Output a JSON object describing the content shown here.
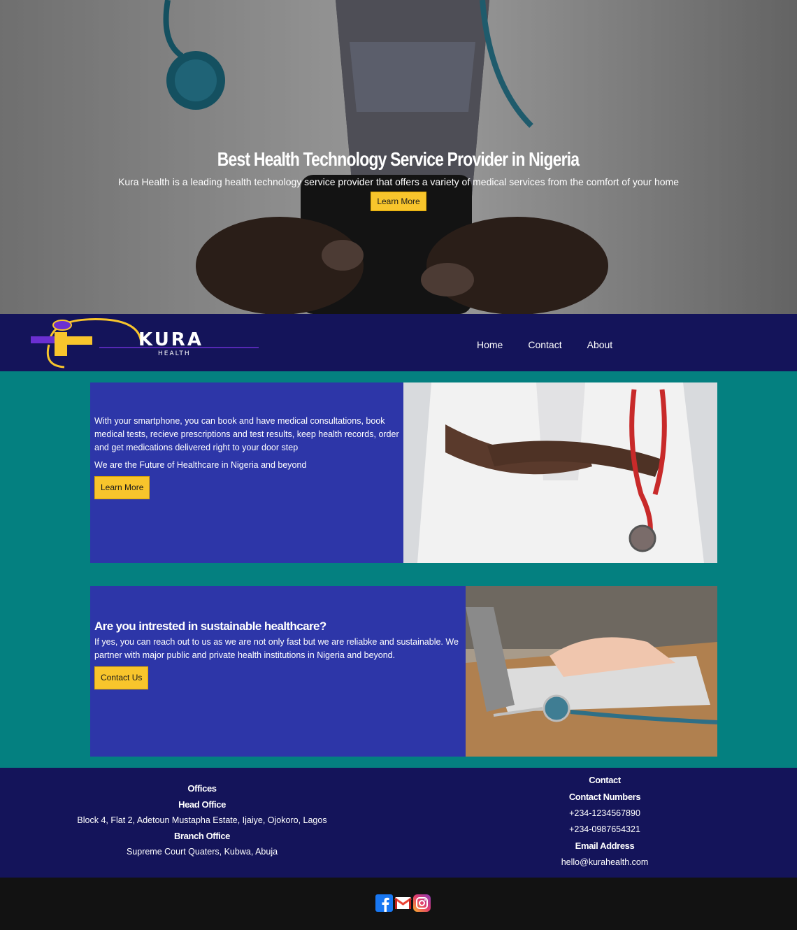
{
  "hero": {
    "title": "Best Health Technology Service Provider in Nigeria",
    "subtitle": "Kura Health is a leading health technology service provider that offers a variety of medical services from the comfort of your home",
    "button_label": "Learn More"
  },
  "nav": {
    "logo_text": "KURA",
    "logo_subtext": "HEALTH",
    "items": [
      {
        "label": "Home"
      },
      {
        "label": "Contact"
      },
      {
        "label": "About"
      }
    ]
  },
  "section1": {
    "paragraph": "With your smartphone, you can book and have medical consultations, book medical tests, recieve prescriptions and test results, keep health records, order and get medications delivered right to your door step",
    "tagline": "We are the Future of Healthcare in Nigeria and beyond",
    "button_label": "Learn More"
  },
  "section2": {
    "heading": "Are you intrested in sustainable healthcare?",
    "paragraph": "If yes, you can reach out to us as we are not only fast but we are reliabke and sustainable. We partner with major public and private health institutions in Nigeria and beyond.",
    "button_label": "Contact Us"
  },
  "footer": {
    "offices": {
      "heading": "Offices",
      "head_office_label": "Head Office",
      "head_office_address": "Block 4, Flat 2, Adetoun Mustapha Estate, Ijaiye, Ojokoro, Lagos",
      "branch_office_label": "Branch Office",
      "branch_office_address": "Supreme Court Quaters, Kubwa, Abuja"
    },
    "contact": {
      "heading": "Contact",
      "numbers_label": "Contact Numbers",
      "phone1": "+234-1234567890",
      "phone2": "+234-0987654321",
      "email_label": "Email Address",
      "email": "hello@kurahealth.com"
    }
  },
  "social": {
    "icons": [
      "facebook-icon",
      "gmail-icon",
      "instagram-icon"
    ]
  },
  "colors": {
    "navy": "#14145a",
    "teal": "#048080",
    "card_blue": "#2d36a8",
    "button_yellow": "#f8c52c",
    "bottom_bar": "#121212"
  }
}
